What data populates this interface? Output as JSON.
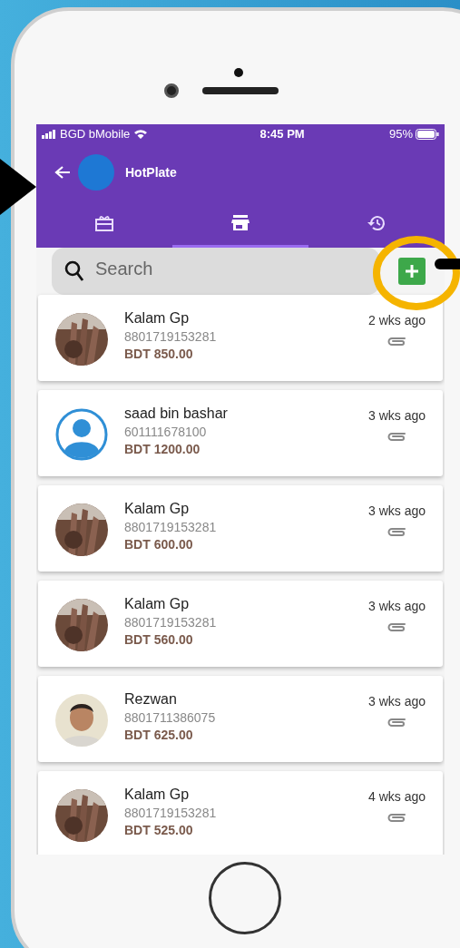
{
  "status_bar": {
    "carrier": "BGD bMobile",
    "time": "8:45 PM",
    "battery": "95%"
  },
  "app_bar": {
    "title": "HotPlate"
  },
  "tabs": [
    {
      "kind": "gift",
      "selected": false
    },
    {
      "kind": "store",
      "selected": true
    },
    {
      "kind": "history",
      "selected": false
    }
  ],
  "search": {
    "placeholder": "Search"
  },
  "contacts": [
    {
      "name": "Kalam Gp",
      "phone": "8801719153281",
      "amount": "BDT 850.00",
      "time": "2 wks ago"
    },
    {
      "kind": "default",
      "name": "saad bin bashar",
      "phone": "601111678100",
      "amount": "BDT 1200.00",
      "time": "3 wks ago"
    },
    {
      "name": "Kalam Gp",
      "phone": "8801719153281",
      "amount": "BDT 600.00",
      "time": "3 wks ago"
    },
    {
      "name": "Kalam Gp",
      "phone": "8801719153281",
      "amount": "BDT 560.00",
      "time": "3 wks ago"
    },
    {
      "kind": "person",
      "name": "Rezwan",
      "phone": "8801711386075",
      "amount": "BDT 625.00",
      "time": "3 wks ago"
    },
    {
      "name": "Kalam Gp",
      "phone": "8801719153281",
      "amount": "BDT 525.00",
      "time": "4 wks ago"
    }
  ]
}
